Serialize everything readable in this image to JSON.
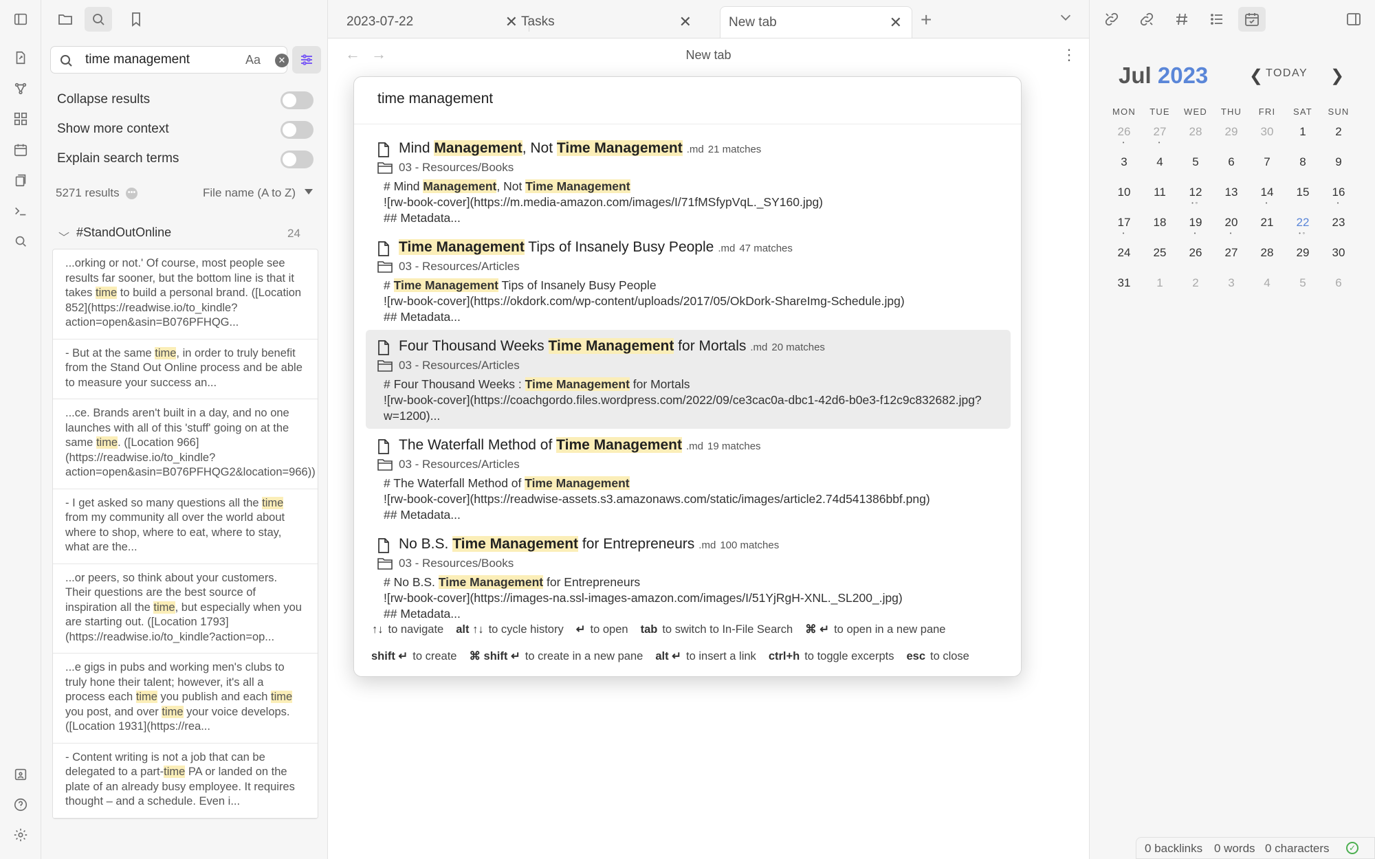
{
  "ribbon": {
    "items": [
      "open-file-icon",
      "graph-icon",
      "canvas-icon",
      "daily-note-icon",
      "templates-icon",
      "terminal-icon",
      "search-icon"
    ],
    "bottom": [
      "vault-icon",
      "help-icon",
      "settings-icon"
    ]
  },
  "left_sidebar": {
    "search_value": "time management",
    "match_case_label": "Aa",
    "options": [
      {
        "label": "Collapse results"
      },
      {
        "label": "Show more context"
      },
      {
        "label": "Explain search terms"
      }
    ],
    "result_count": "5271 results",
    "sort_label": "File name (A to Z)",
    "group": {
      "title": "#StandOutOnline",
      "count": "24"
    },
    "snippets": [
      [
        [
          "...orking or not.' Of course, most people see results far sooner, but the bottom line is that it takes ",
          ""
        ],
        [
          "time",
          "hl"
        ],
        [
          " to build a personal brand. ([Location 852](https://readwise.io/to_kindle?action=open&asin=B076PFHQG...",
          ""
        ]
      ],
      [
        [
          "- But at the same ",
          ""
        ],
        [
          "time",
          "hl"
        ],
        [
          ", in order to truly benefit from the Stand Out Online process and be able to measure your success an...",
          ""
        ]
      ],
      [
        [
          "...ce. Brands aren't built in a day, and no one launches with all of this 'stuff' going on at the same ",
          ""
        ],
        [
          "time",
          "hl"
        ],
        [
          ". ([Location 966](https://readwise.io/to_kindle?action=open&asin=B076PFHQG2&location=966))",
          ""
        ]
      ],
      [
        [
          "- I get asked so many questions all the ",
          ""
        ],
        [
          "time",
          "hl"
        ],
        [
          " from my community all over the world about where to shop, where to eat, where to stay, what are the...",
          ""
        ]
      ],
      [
        [
          "...or peers, so think about your customers. Their questions are the best source of inspiration all the ",
          ""
        ],
        [
          "time",
          "hl"
        ],
        [
          ", but especially when you are starting out. ([Location 1793](https://readwise.io/to_kindle?action=op...",
          ""
        ]
      ],
      [
        [
          "...e gigs in pubs and working men's clubs to truly hone their talent; however, it's all a process each ",
          ""
        ],
        [
          "time",
          "hl"
        ],
        [
          " you publish and each ",
          ""
        ],
        [
          "time",
          "hl"
        ],
        [
          " you post, and over ",
          ""
        ],
        [
          "time",
          "hl"
        ],
        [
          " your voice develops. ([Location 1931](https://rea...",
          ""
        ]
      ],
      [
        [
          "- Content writing is not a job that can be delegated to a part-",
          ""
        ],
        [
          "time",
          "hl"
        ],
        [
          " PA or landed on the plate of an already busy employee. It requires thought – and a schedule. Even i...",
          ""
        ]
      ]
    ]
  },
  "tabs": [
    {
      "label": "2023-07-22"
    },
    {
      "label": "Tasks"
    },
    {
      "label": "New tab"
    }
  ],
  "view": {
    "title": "New tab",
    "new_tab_symbol": "+"
  },
  "modal": {
    "query": "time management",
    "results": [
      {
        "title": [
          [
            "Mind ",
            ""
          ],
          [
            "Management",
            "b hl"
          ],
          [
            ", Not ",
            ""
          ],
          [
            "Time Management",
            "b hl"
          ]
        ],
        "ext": ".md",
        "matches": "21 matches",
        "path": "03 - Resources/Books",
        "excerpt": [
          [
            "# Mind ",
            ""
          ],
          [
            "Management",
            "b hl"
          ],
          [
            ", Not ",
            ""
          ],
          [
            "Time Management",
            "b hl"
          ],
          [
            "\n![rw-book-cover](https://m.media-amazon.com/images/I/71fMSfypVqL._SY160.jpg)\n## Metadata...",
            ""
          ]
        ],
        "selected": false
      },
      {
        "title": [
          [
            "Time Management",
            "b hl"
          ],
          [
            " Tips of Insanely Busy People",
            ""
          ]
        ],
        "ext": ".md",
        "matches": "47 matches",
        "path": "03 - Resources/Articles",
        "excerpt": [
          [
            "# ",
            ""
          ],
          [
            "Time Management",
            "b hl"
          ],
          [
            " Tips of Insanely Busy People\n![rw-book-cover](https://okdork.com/wp-content/uploads/2017/05/OkDork-ShareImg-Schedule.jpg)\n## Metadata...",
            ""
          ]
        ],
        "selected": false
      },
      {
        "title": [
          [
            "Four Thousand Weeks  ",
            ""
          ],
          [
            "Time Management",
            "b hl"
          ],
          [
            " for Mortals",
            ""
          ]
        ],
        "ext": ".md",
        "matches": "20 matches",
        "path": "03 - Resources/Articles",
        "excerpt": [
          [
            "# Four Thousand Weeks : ",
            ""
          ],
          [
            "Time Management",
            "b hl"
          ],
          [
            " for Mortals\n![rw-book-cover](https://coachgordo.files.wordpress.com/2022/09/ce3cac0a-dbc1-42d6-b0e3-f12c9c832682.jpg?w=1200)...",
            ""
          ]
        ],
        "selected": true
      },
      {
        "title": [
          [
            "The Waterfall Method of ",
            ""
          ],
          [
            "Time Management",
            "b hl"
          ]
        ],
        "ext": ".md",
        "matches": "19 matches",
        "path": "03 - Resources/Articles",
        "excerpt": [
          [
            "# The Waterfall Method of ",
            ""
          ],
          [
            "Time Management",
            "b hl"
          ],
          [
            "\n![rw-book-cover](https://readwise-assets.s3.amazonaws.com/static/images/article2.74d541386bbf.png)\n## Metadata...",
            ""
          ]
        ],
        "selected": false
      },
      {
        "title": [
          [
            "No B.S. ",
            ""
          ],
          [
            "Time Management",
            "b hl"
          ],
          [
            " for Entrepreneurs",
            ""
          ]
        ],
        "ext": ".md",
        "matches": "100 matches",
        "path": "03 - Resources/Books",
        "excerpt": [
          [
            "# No B.S. ",
            ""
          ],
          [
            "Time Management",
            "b hl"
          ],
          [
            " for Entrepreneurs\n![rw-book-cover](https://images-na.ssl-images-amazon.com/images/I/51YjRgH-XNL._SL200_.jpg)\n## Metadata...",
            ""
          ]
        ],
        "selected": false
      }
    ],
    "hints_row1": [
      {
        "key": "↑↓",
        "text": "to navigate"
      },
      {
        "key": "alt ↑↓",
        "text": "to cycle history"
      },
      {
        "key": "↵",
        "text": "to open"
      },
      {
        "key": "tab",
        "text": "to switch to In-File Search"
      },
      {
        "key": "⌘ ↵",
        "text": "to open in a new pane"
      }
    ],
    "hints_row2": [
      {
        "key": "shift ↵",
        "text": "to create"
      },
      {
        "key": "⌘ shift ↵",
        "text": "to create in a new pane"
      },
      {
        "key": "alt ↵",
        "text": "to insert a link"
      },
      {
        "key": "ctrl+h",
        "text": "to toggle excerpts"
      },
      {
        "key": "esc",
        "text": "to close"
      }
    ]
  },
  "calendar": {
    "month": "Jul",
    "year": "2023",
    "today_label": "TODAY",
    "weekdays": [
      "MON",
      "TUE",
      "WED",
      "THU",
      "FRI",
      "SAT",
      "SUN"
    ],
    "weeks": [
      [
        {
          "d": "26",
          "dim": true,
          "dots": "•"
        },
        {
          "d": "27",
          "dim": true,
          "dots": "•"
        },
        {
          "d": "28",
          "dim": true
        },
        {
          "d": "29",
          "dim": true
        },
        {
          "d": "30",
          "dim": true
        },
        {
          "d": "1"
        },
        {
          "d": "2"
        }
      ],
      [
        {
          "d": "3"
        },
        {
          "d": "4"
        },
        {
          "d": "5"
        },
        {
          "d": "6"
        },
        {
          "d": "7"
        },
        {
          "d": "8"
        },
        {
          "d": "9"
        }
      ],
      [
        {
          "d": "10"
        },
        {
          "d": "11"
        },
        {
          "d": "12",
          "dots": "•∘"
        },
        {
          "d": "13"
        },
        {
          "d": "14",
          "dots": "•"
        },
        {
          "d": "15"
        },
        {
          "d": "16",
          "dots": "•"
        }
      ],
      [
        {
          "d": "17",
          "dots": "•"
        },
        {
          "d": "18"
        },
        {
          "d": "19",
          "dots": "•"
        },
        {
          "d": "20",
          "dots": "•"
        },
        {
          "d": "21"
        },
        {
          "d": "22",
          "today": true,
          "dots": "•∘"
        },
        {
          "d": "23"
        }
      ],
      [
        {
          "d": "24"
        },
        {
          "d": "25"
        },
        {
          "d": "26"
        },
        {
          "d": "27"
        },
        {
          "d": "28"
        },
        {
          "d": "29"
        },
        {
          "d": "30"
        }
      ],
      [
        {
          "d": "31"
        },
        {
          "d": "1",
          "dim": true
        },
        {
          "d": "2",
          "dim": true
        },
        {
          "d": "3",
          "dim": true
        },
        {
          "d": "4",
          "dim": true
        },
        {
          "d": "5",
          "dim": true
        },
        {
          "d": "6",
          "dim": true
        }
      ]
    ]
  },
  "status": {
    "backlinks": "0 backlinks",
    "words": "0 words",
    "characters": "0 characters"
  }
}
